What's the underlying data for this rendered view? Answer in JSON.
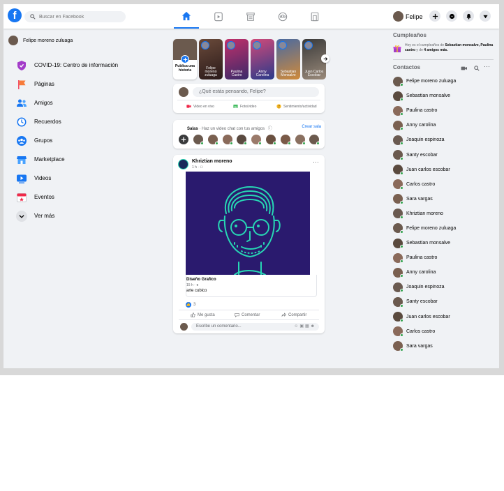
{
  "topbar": {
    "search_placeholder": "Buscar en Facebook",
    "logo_letter": "f",
    "user_name": "Felipe",
    "nav_items": [
      "home-icon",
      "watch-icon",
      "marketplace-icon",
      "groups-icon",
      "gaming-icon"
    ]
  },
  "left": {
    "profile_name": "Felipe moreno zuluaga",
    "items": [
      {
        "label": "COVID-19: Centro de información",
        "icon": "covid-shield-icon",
        "color": "#a33cc9"
      },
      {
        "label": "Páginas",
        "icon": "flag-icon",
        "color": "#f35369"
      },
      {
        "label": "Amigos",
        "icon": "friends-icon",
        "color": "#1877f2"
      },
      {
        "label": "Recuerdos",
        "icon": "clock-icon",
        "color": "#1877f2"
      },
      {
        "label": "Grupos",
        "icon": "groups-icon",
        "color": "#1877f2"
      },
      {
        "label": "Marketplace",
        "icon": "shop-icon",
        "color": "#1877f2"
      },
      {
        "label": "Videos",
        "icon": "video-icon",
        "color": "#1877f2"
      },
      {
        "label": "Eventos",
        "icon": "calendar-icon",
        "color": "#f02849"
      },
      {
        "label": "Ver más",
        "icon": "chevron-down-icon",
        "color": "#65676b"
      }
    ]
  },
  "stories": {
    "create_label": "Publica una historia",
    "items": [
      {
        "name": "Felipe moreno zuluaga"
      },
      {
        "name": "Paulina Castro"
      },
      {
        "name": "Anny Carolina"
      },
      {
        "name": "Sebastian Monsalve"
      },
      {
        "name": "Juan Carlos Escobar"
      }
    ]
  },
  "composer": {
    "placeholder": "¿Qué estás pensando, Felipe?",
    "actions": [
      "Video en vivo",
      "Foto/video",
      "Sentimiento/actividad"
    ]
  },
  "rooms": {
    "title": "Salas",
    "subtitle": "· Haz un video chat con tus amigos",
    "create_label": "Crear sala"
  },
  "post": {
    "author": "Khriztian moreno",
    "time": "1 h",
    "link_title": "Diseño Grafico",
    "link_time": "15 h",
    "link_desc": "arte cubico",
    "likes": "3",
    "like_label": "Me gusta",
    "comment_label": "Comentar",
    "share_label": "Compartir",
    "comment_placeholder": "Escribe un comentario..."
  },
  "right": {
    "birthdays_title": "Cumpleaños",
    "birthday_text_1": "Hoy es el cumpleaños de ",
    "birthday_names": "Sebastian monsalve, Paulina castro",
    "birthday_text_2": " y de ",
    "birthday_more": "4 amigos más.",
    "contacts_title": "Contactos",
    "contacts": [
      "Felipe moreno zuluaga",
      "Sebastian monsalve",
      "Paulina castro",
      "Anny carolina",
      "Joaquin espinoza",
      "Santy escobar",
      "Juan carlos escobar",
      "Carlos castro",
      "Sara vargas",
      "Khriztian moreno",
      "Felipe moreno zuluaga",
      "Sebastian monsalve",
      "Paulina castro",
      "Anny carolina",
      "Joaquin espinoza",
      "Santy escobar",
      "Juan carlos escobar",
      "Carlos castro",
      "Sara vargas"
    ]
  },
  "colors": {
    "brand": "#1877f2",
    "online": "#31a24c",
    "post_bg": "#2a1a6e",
    "post_line": "#27d7b4"
  }
}
